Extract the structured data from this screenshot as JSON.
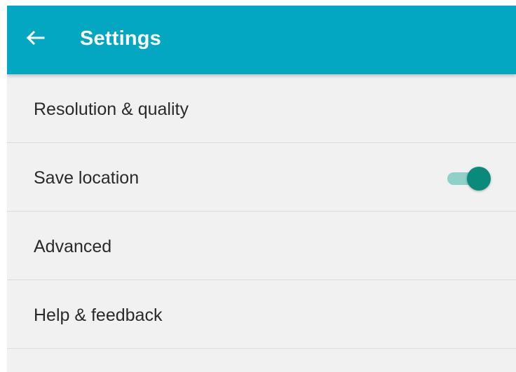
{
  "header": {
    "title": "Settings",
    "back_icon": "arrow-left-icon"
  },
  "colors": {
    "appbar": "#04a7c1",
    "background": "#f1f1f1",
    "toggle_thumb": "#0a8a7a",
    "toggle_track": "#8fd1c8"
  },
  "settings": {
    "items": [
      {
        "label": "Resolution & quality"
      },
      {
        "label": "Save location",
        "toggle_on": true
      },
      {
        "label": "Advanced"
      },
      {
        "label": "Help & feedback"
      }
    ]
  }
}
